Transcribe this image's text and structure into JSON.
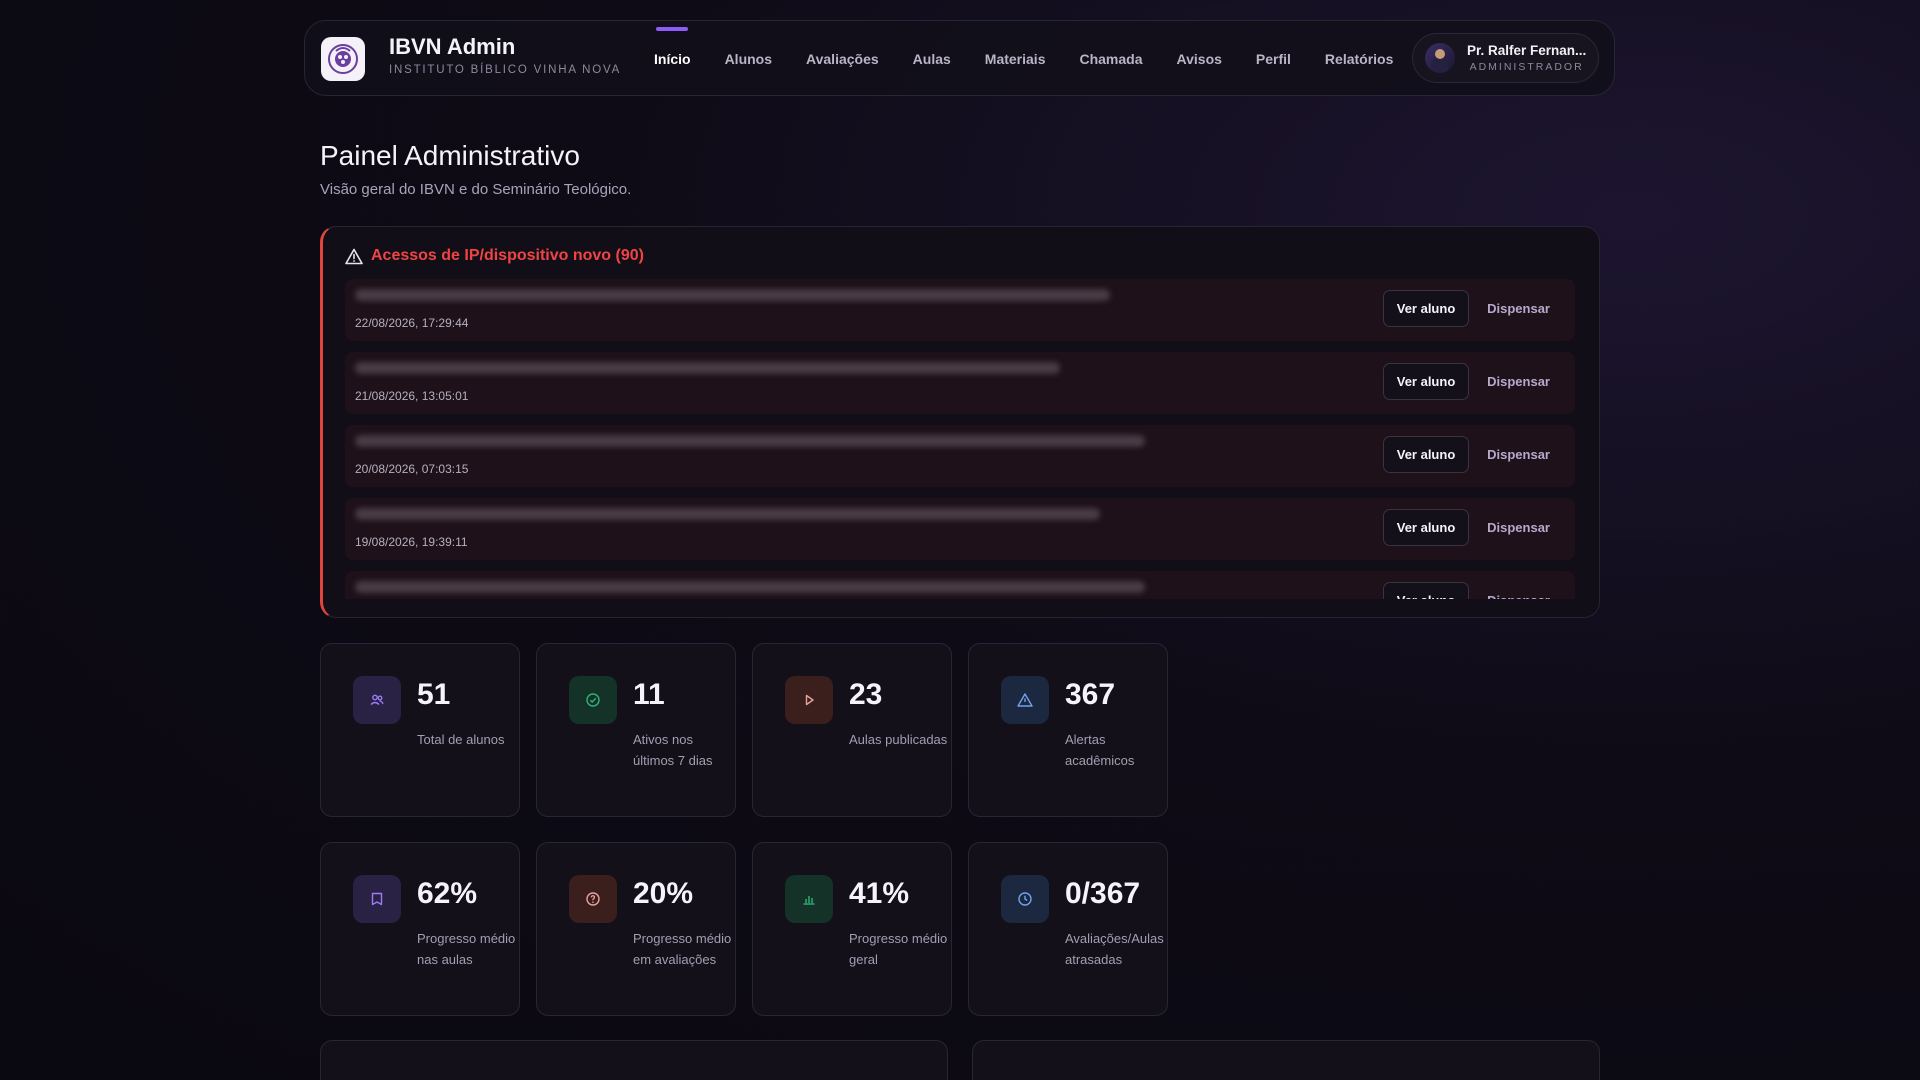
{
  "brand": {
    "title": "IBVN Admin",
    "subtitle": "INSTITUTO BÍBLICO VINHA NOVA"
  },
  "nav": {
    "items": [
      {
        "label": "Início",
        "active": true
      },
      {
        "label": "Alunos"
      },
      {
        "label": "Avaliações"
      },
      {
        "label": "Aulas"
      },
      {
        "label": "Materiais"
      },
      {
        "label": "Chamada"
      },
      {
        "label": "Avisos"
      },
      {
        "label": "Perfil"
      },
      {
        "label": "Relatórios"
      }
    ]
  },
  "user": {
    "name": "Pr. Ralfer Fernan...",
    "role": "ADMINISTRADOR"
  },
  "page": {
    "title": "Painel Administrativo",
    "subtitle": "Visão geral do IBVN e do Seminário Teológico."
  },
  "alerts": {
    "title": "Acessos de IP/dispositivo novo (90)",
    "rows": [
      {
        "date": "22/08/2026, 17:29:44"
      },
      {
        "date": "21/08/2026, 13:05:01"
      },
      {
        "date": "20/08/2026, 07:03:15"
      },
      {
        "date": "19/08/2026, 19:39:11"
      },
      {
        "date": ""
      }
    ],
    "view_label": "Ver aluno",
    "dismiss_label": "Dispensar"
  },
  "stats": [
    {
      "value": "51",
      "label": "Total de alunos",
      "icon": "users-icon",
      "color": "#8b6cf0"
    },
    {
      "value": "11",
      "label": "Ativos nos últimos 7 dias",
      "icon": "check-circle-icon",
      "color": "#2fb47a"
    },
    {
      "value": "23",
      "label": "Aulas publicadas",
      "icon": "play-icon",
      "color": "#e07a54"
    },
    {
      "value": "367",
      "label": "Alertas acadêmicos",
      "icon": "warning-icon",
      "color": "#5b8ee6"
    },
    {
      "value": "62%",
      "label": "Progresso médio nas aulas",
      "icon": "book-icon",
      "color": "#8b6cf0"
    },
    {
      "value": "20%",
      "label": "Progresso médio em avaliações",
      "icon": "question-icon",
      "color": "#e07a54"
    },
    {
      "value": "41%",
      "label": "Progresso médio geral",
      "icon": "bar-chart-icon",
      "color": "#2fb47a"
    },
    {
      "value": "0/367",
      "label": "Avaliações/Aulas atrasadas",
      "icon": "clock-icon",
      "color": "#5b8ee6"
    }
  ]
}
